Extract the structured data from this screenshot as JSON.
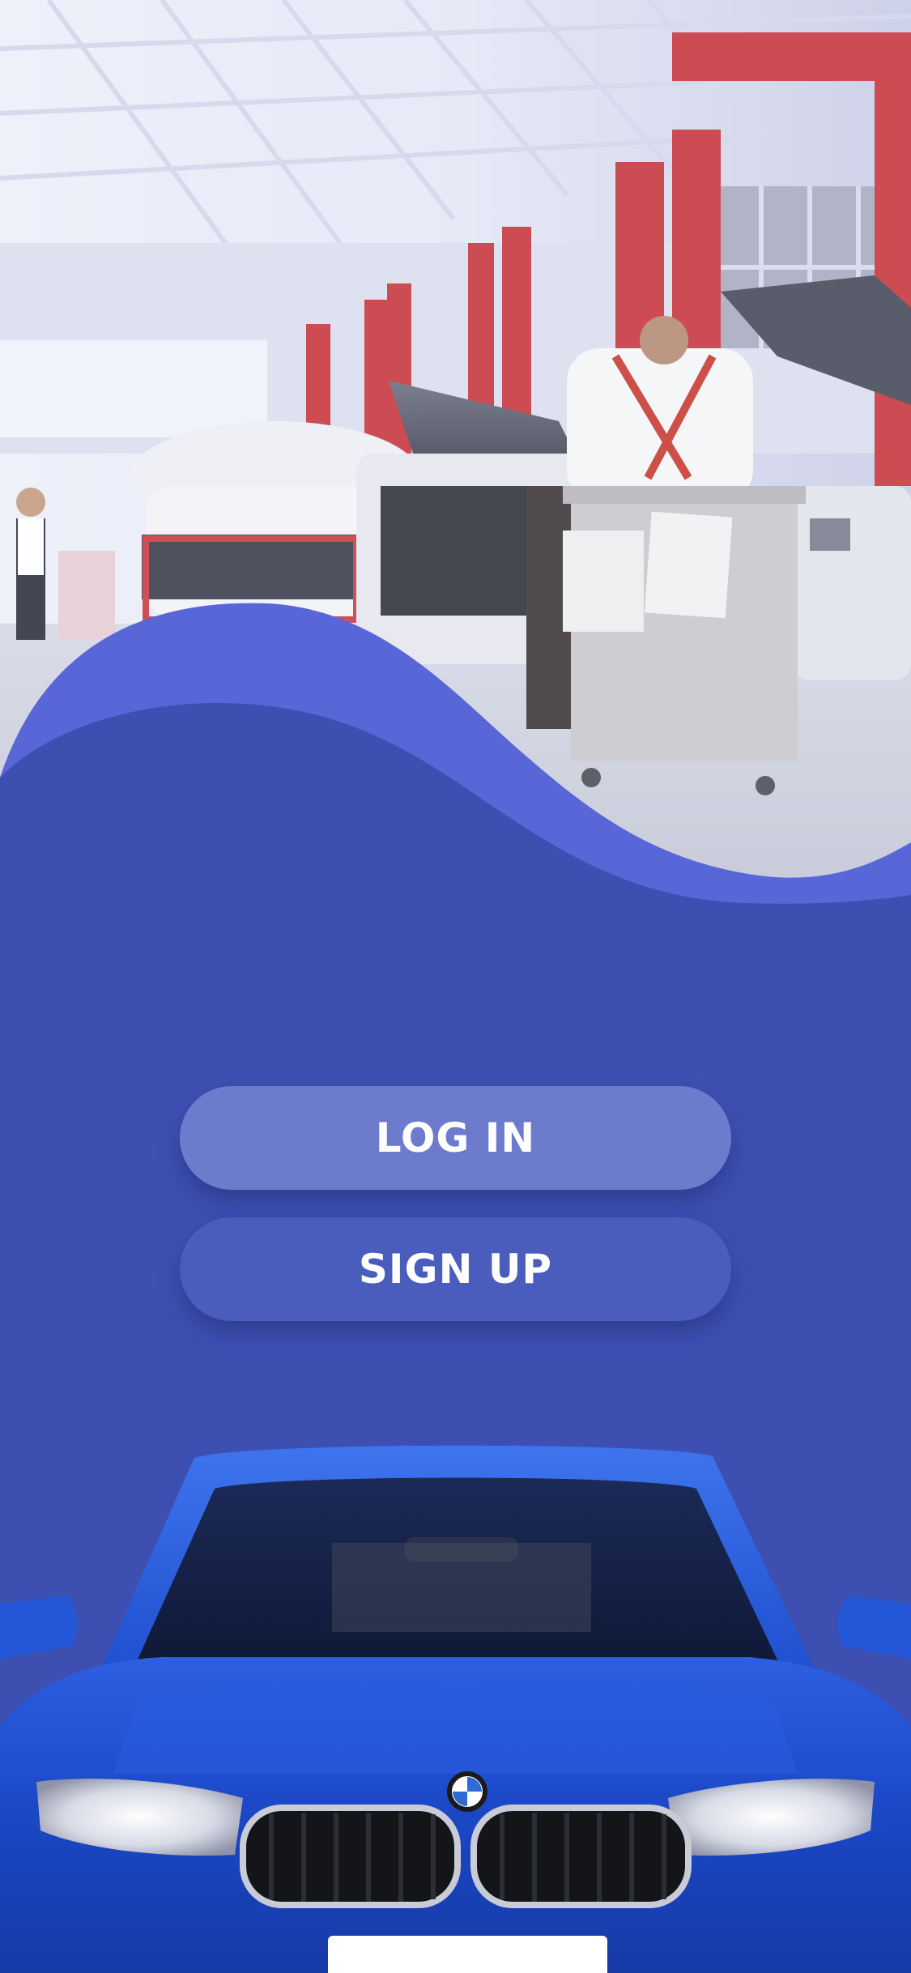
{
  "hero": {
    "image": "garage-workshop-photo",
    "overlay_color": "#5866d8"
  },
  "actions": {
    "login_label": "LOG IN",
    "signup_label": "SIGN UP"
  },
  "car": {
    "image": "blue-car-front-photo",
    "color": "#1f4fd1"
  },
  "colors": {
    "background": "#3e4fb2",
    "wave": "#5866d8",
    "login_button": "#6d7bcd",
    "signup_button": "#4a5cbc"
  }
}
